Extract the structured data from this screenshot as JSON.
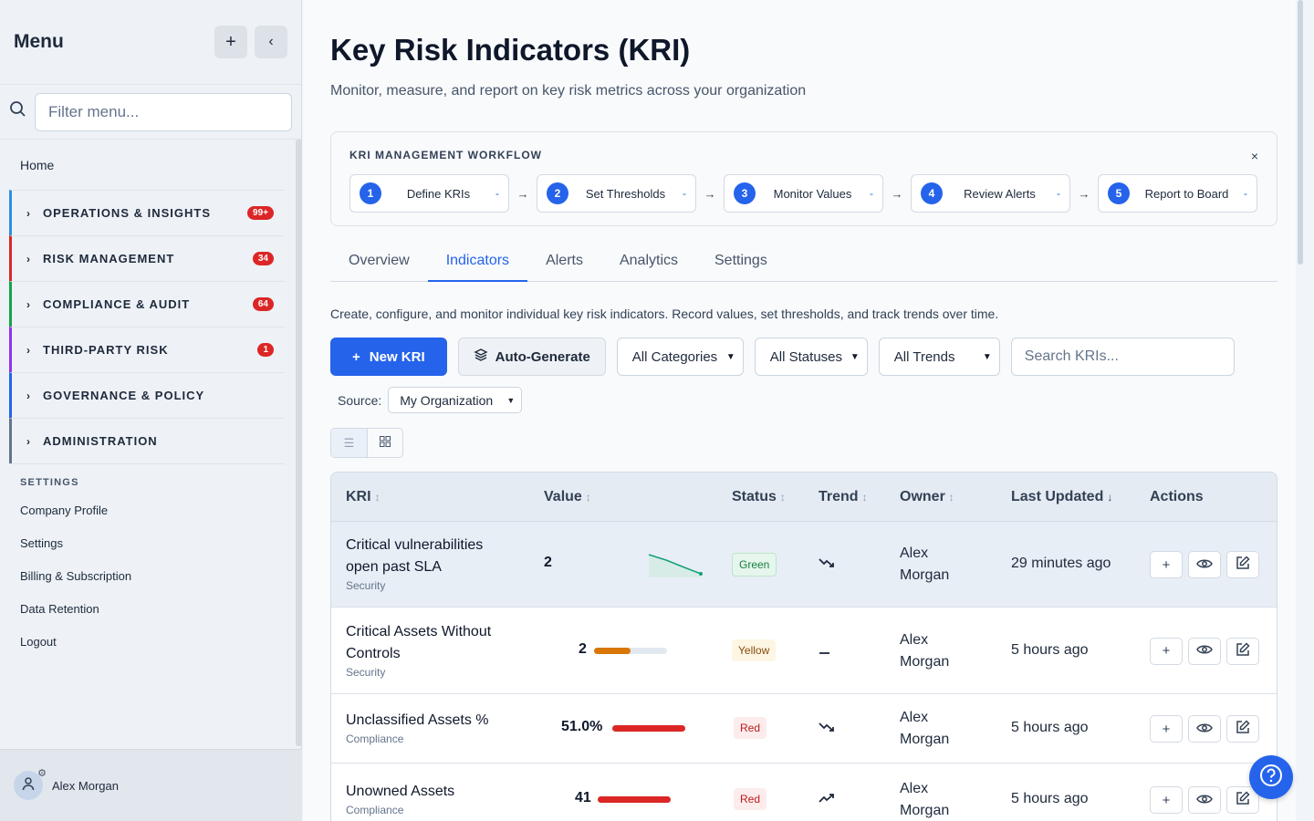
{
  "sidebar": {
    "title": "Menu",
    "add_icon": "plus-icon",
    "collapse_icon": "chevron-left-icon",
    "filter_placeholder": "Filter menu...",
    "home": "Home",
    "groups": [
      {
        "label": "OPERATIONS & INSIGHTS",
        "badge": "99+",
        "color": "#2f8fdc"
      },
      {
        "label": "RISK MANAGEMENT",
        "badge": "34",
        "color": "#dc2626"
      },
      {
        "label": "COMPLIANCE & AUDIT",
        "badge": "64",
        "color": "#16a34a"
      },
      {
        "label": "THIRD-PARTY RISK",
        "badge": "1",
        "color": "#9333ea"
      },
      {
        "label": "GOVERNANCE & POLICY",
        "badge": "",
        "color": "#2563eb"
      },
      {
        "label": "ADMINISTRATION",
        "badge": "",
        "color": "#64748b"
      }
    ],
    "settings_heading": "SETTINGS",
    "settings_links": [
      "Company Profile",
      "Settings",
      "Billing & Subscription",
      "Data Retention",
      "Logout"
    ],
    "user": "Alex Morgan"
  },
  "page": {
    "title": "Key Risk Indicators (KRI)",
    "subtitle": "Monitor, measure, and report on key risk metrics across your organization"
  },
  "workflow": {
    "title": "KRI MANAGEMENT WORKFLOW",
    "close": "×",
    "steps": [
      {
        "num": "1",
        "label": "Define KRIs",
        "status": "-"
      },
      {
        "num": "2",
        "label": "Set Thresholds",
        "status": "-"
      },
      {
        "num": "3",
        "label": "Monitor Values",
        "status": "-"
      },
      {
        "num": "4",
        "label": "Review Alerts",
        "status": "-"
      },
      {
        "num": "5",
        "label": "Report to Board",
        "status": "-"
      }
    ],
    "arrow": "→"
  },
  "tabs": [
    "Overview",
    "Indicators",
    "Alerts",
    "Analytics",
    "Settings"
  ],
  "active_tab": "Indicators",
  "description": "Create, configure, and monitor individual key risk indicators. Record values, set thresholds, and track trends over time.",
  "toolbar": {
    "new_kri": "New KRI",
    "auto_generate": "Auto-Generate",
    "categories": "All Categories",
    "statuses": "All Statuses",
    "trends": "All Trends",
    "search_placeholder": "Search KRIs..."
  },
  "source": {
    "label": "Source:",
    "value": "My Organization"
  },
  "table": {
    "headers": {
      "kri": "KRI",
      "value": "Value",
      "status": "Status",
      "trend": "Trend",
      "owner": "Owner",
      "updated": "Last Updated",
      "actions": "Actions"
    },
    "rows": [
      {
        "name": "Critical vulnerabilities open past SLA",
        "category": "Security",
        "value": "2",
        "status": "Green",
        "trend": "decreasing",
        "owner": "Alex Morgan",
        "updated": "29 minutes ago",
        "visual": "sparkline"
      },
      {
        "name": "Critical Assets Without Controls",
        "category": "Security",
        "value": "2",
        "status": "Yellow",
        "trend": "stable",
        "owner": "Alex Morgan",
        "updated": "5 hours ago",
        "visual": "bar",
        "level": 0.5,
        "bar_color": "#d97706"
      },
      {
        "name": "Unclassified Assets %",
        "category": "Compliance",
        "value": "51.0%",
        "status": "Red",
        "trend": "decreasing",
        "owner": "Alex Morgan",
        "updated": "5 hours ago",
        "visual": "bar",
        "level": 1.0,
        "bar_color": "#dc2626"
      },
      {
        "name": "Unowned Assets",
        "category": "Compliance",
        "value": "41",
        "status": "Red",
        "trend": "increasing",
        "owner": "Alex Morgan",
        "updated": "5 hours ago",
        "visual": "bar",
        "level": 1.0,
        "bar_color": "#dc2626"
      }
    ]
  },
  "colors": {
    "accent": "#2563eb",
    "green": "#15803d",
    "yellow": "#854d0e",
    "red": "#b91c1c"
  }
}
